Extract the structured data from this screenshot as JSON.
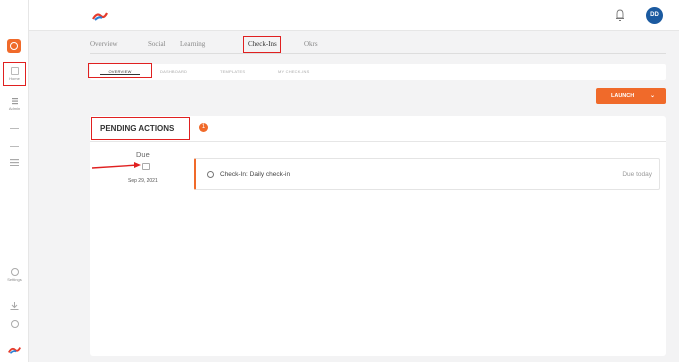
{
  "user": {
    "initials": "DD"
  },
  "colors": {
    "accent": "#f06a2a",
    "avatar": "#1b5aa0",
    "highlight": "#e02020"
  },
  "rail": {
    "home_label": "Home",
    "admin_label": "Admin",
    "settings_label": "Settings"
  },
  "tabs": [
    {
      "label": "Overview"
    },
    {
      "label": "Social"
    },
    {
      "label": "Learning"
    },
    {
      "label": "Check-Ins"
    },
    {
      "label": "Okrs"
    }
  ],
  "subtabs": [
    {
      "label": "OVERVIEW"
    },
    {
      "label": "DASHBOARD"
    },
    {
      "label": "TEMPLATES"
    },
    {
      "label": "MY CHECK-INS"
    }
  ],
  "launch": {
    "label": "LAUNCH"
  },
  "pending": {
    "title": "PENDING ACTIONS",
    "count": "1",
    "due_label": "Due",
    "due_date": "Sep 29, 2021",
    "item_title": "Check-In: Daily check-in",
    "item_due": "Due today"
  }
}
